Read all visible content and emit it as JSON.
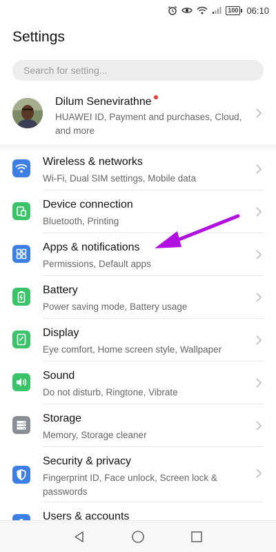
{
  "status_bar": {
    "battery": "100",
    "time": "06:10"
  },
  "header": {
    "title": "Settings"
  },
  "search": {
    "placeholder": "Search for setting..."
  },
  "account": {
    "name": "Dilum Senevirathne",
    "description": "HUAWEI ID, Payment and purchases, Cloud, and more"
  },
  "items": [
    {
      "title": "Wireless & networks",
      "subtitle": "Wi-Fi, Dual SIM settings, Mobile data",
      "icon": "wifi-icon",
      "color": "#3d7fe3"
    },
    {
      "title": "Device connection",
      "subtitle": "Bluetooth, Printing",
      "icon": "device-connection-icon",
      "color": "#3bc36a"
    },
    {
      "title": "Apps & notifications",
      "subtitle": "Permissions, Default apps",
      "icon": "apps-grid-icon",
      "color": "#3d7fe3"
    },
    {
      "title": "Battery",
      "subtitle": "Power saving mode, Battery usage",
      "icon": "battery-icon",
      "color": "#3bc36a"
    },
    {
      "title": "Display",
      "subtitle": "Eye comfort, Home screen style, Wallpaper",
      "icon": "display-icon",
      "color": "#3bc36a"
    },
    {
      "title": "Sound",
      "subtitle": "Do not disturb, Ringtone, Vibrate",
      "icon": "sound-icon",
      "color": "#3bc36a"
    },
    {
      "title": "Storage",
      "subtitle": "Memory, Storage cleaner",
      "icon": "storage-icon",
      "color": "#8a8f96"
    },
    {
      "title": "Security & privacy",
      "subtitle": "Fingerprint ID, Face unlock, Screen lock & passwords",
      "icon": "shield-icon",
      "color": "#3d7fe3"
    },
    {
      "title": "Users & accounts",
      "subtitle": "",
      "icon": "users-icon",
      "color": "#3d7fe3"
    }
  ],
  "annotation": {
    "color": "#b010e0"
  }
}
